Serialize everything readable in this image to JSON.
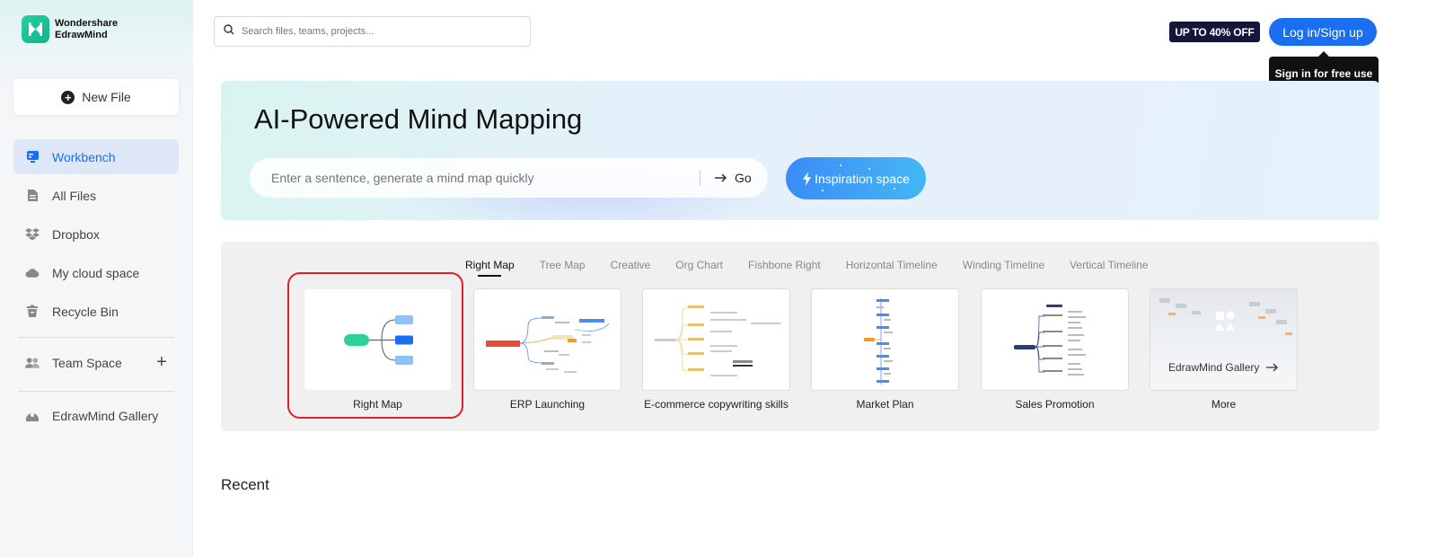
{
  "brand": {
    "line1": "Wondershare",
    "line2": "EdrawMind",
    "logo_icon": "edrawmind-logo-icon",
    "accent": "#1fc49a"
  },
  "sidebar": {
    "new_file_label": "New File",
    "items": [
      {
        "label": "Workbench",
        "icon": "workbench-icon",
        "active": true
      },
      {
        "label": "All Files",
        "icon": "file-icon"
      },
      {
        "label": "Dropbox",
        "icon": "dropbox-icon"
      },
      {
        "label": "My cloud space",
        "icon": "cloud-icon"
      },
      {
        "label": "Recycle Bin",
        "icon": "trash-icon"
      },
      {
        "label": "Team Space",
        "icon": "team-icon"
      },
      {
        "label": "EdrawMind Gallery",
        "icon": "gallery-icon"
      }
    ]
  },
  "header": {
    "search_placeholder": "Search files, teams, projects...",
    "promo": "UP TO 40% OFF",
    "login_label": "Log in/Sign up",
    "tooltip": "Sign in for free use",
    "accent": "#1a6ef0"
  },
  "ai_banner": {
    "title": "AI-Powered Mind Mapping",
    "input_placeholder": "Enter a sentence, generate a mind map quickly",
    "go_label": "Go",
    "inspiration_label": "Inspiration space"
  },
  "templates": {
    "tabs": [
      "Right Map",
      "Tree Map",
      "Creative",
      "Org Chart",
      "Fishbone Right",
      "Horizontal Timeline",
      "Winding Timeline",
      "Vertical Timeline"
    ],
    "active_tab": "Right Map",
    "cards": [
      {
        "label": "Right Map",
        "selected": true
      },
      {
        "label": "ERP Launching"
      },
      {
        "label": "E-commerce copywriting skills"
      },
      {
        "label": "Market Plan"
      },
      {
        "label": "Sales Promotion"
      },
      {
        "label": "More",
        "thumb_label": "EdrawMind Gallery"
      }
    ],
    "highlight_color": "#e0202a"
  },
  "recent": {
    "heading": "Recent"
  }
}
